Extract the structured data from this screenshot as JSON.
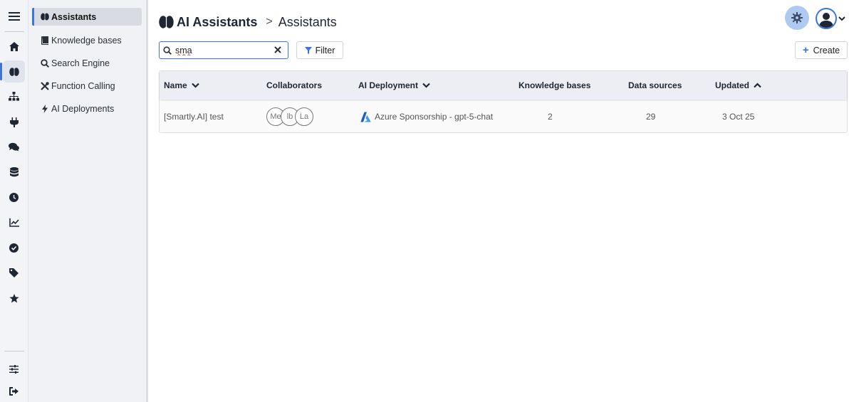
{
  "rail": {
    "items": [
      "menu",
      "home",
      "assistants",
      "hierarchy",
      "plugin",
      "chat",
      "database",
      "history",
      "analytics",
      "check",
      "tags",
      "favorites",
      "settings-sliders",
      "logout"
    ]
  },
  "submenu": {
    "items": [
      {
        "label": "Assistants",
        "icon": "brain-icon"
      },
      {
        "label": "Knowledge bases",
        "icon": "book-icon"
      },
      {
        "label": "Search Engine",
        "icon": "search-icon"
      },
      {
        "label": "Function Calling",
        "icon": "tools-icon"
      },
      {
        "label": "AI Deployments",
        "icon": "bolt-icon"
      }
    ]
  },
  "header": {
    "title": "AI Assistants",
    "separator": ">",
    "subtitle": "Assistants"
  },
  "toolbar": {
    "search_value": "sma",
    "filter_label": "Filter",
    "create_label": "Create"
  },
  "table": {
    "columns": [
      "Name",
      "Collaborators",
      "AI Deployment",
      "Knowledge bases",
      "Data sources",
      "Updated"
    ],
    "rows": [
      {
        "name": "[Smartly.AI] test",
        "collaborators": [
          "Me",
          "lb",
          "La"
        ],
        "deployment": "Azure Sponsorship - gpt-5-chat",
        "knowledge_bases": "2",
        "data_sources": "29",
        "updated": "3 Oct 25"
      }
    ]
  },
  "colors": {
    "accent": "#3a73e8",
    "gear_bg": "#aecaf0"
  }
}
